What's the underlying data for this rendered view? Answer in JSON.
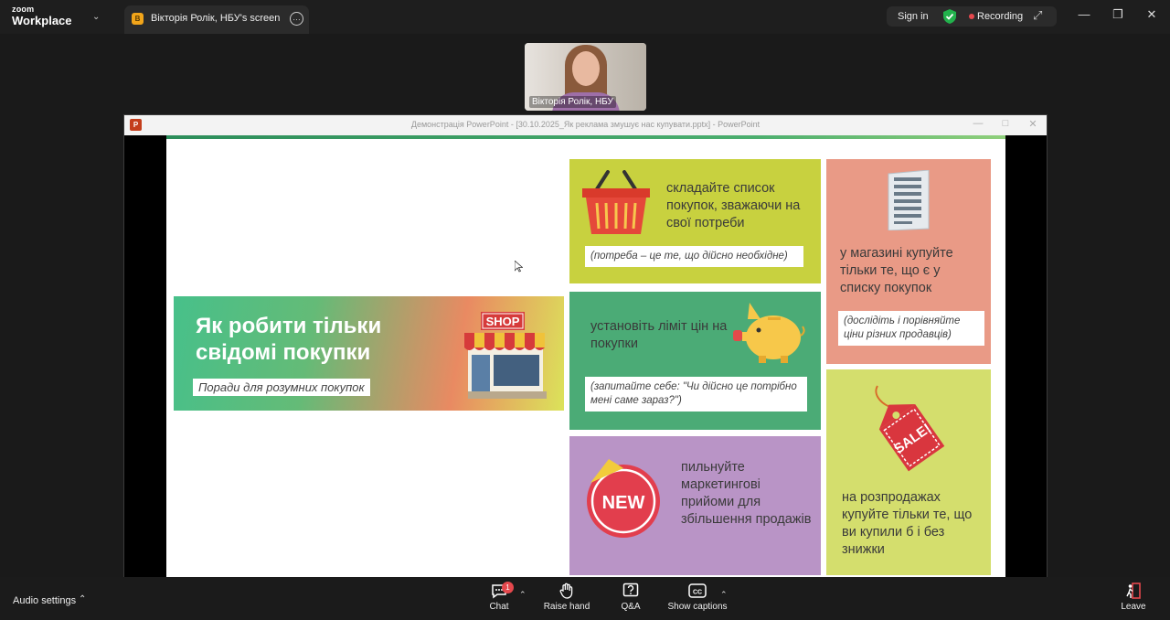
{
  "app": {
    "brand_top": "zoom",
    "brand_bottom": "Workplace"
  },
  "tab": {
    "badge_letter": "В",
    "title": "Вікторія Ролік, НБУ's screen"
  },
  "status": {
    "sign_in": "Sign in",
    "recording": "Recording"
  },
  "participant": {
    "name": "Вікторія Ролік, НБУ"
  },
  "ppt_window": {
    "caption": "Демонстрація PowerPoint - [30.10.2025_Як реклама змушує нас купувати.pptx] - PowerPoint"
  },
  "slide": {
    "hero_title": "Як робити тільки свідомі покупки",
    "hero_subtitle": "Поради для розумних покупок",
    "shop_label": "SHOP",
    "new_label": "NEW",
    "sale_label": "SALE!",
    "tip1_text": "складайте список покупок, зважаючи на свої потреби",
    "tip1_note": "(потреба – це те, що дійсно необхідне)",
    "tip2_text": "установіть ліміт цін на покупки",
    "tip2_note": "(запитайте себе: \"Чи дійсно це потрібно мені саме зараз?\")",
    "tip3_text": "пильнуйте маркетингові прийоми для збільшення продажів",
    "tip4_text": "у магазині купуйте тільки те, що є у списку покупок",
    "tip4_note": "(дослідіть і порівняйте ціни різних продавців)",
    "tip5_text": "на розпродажах купуйте тільки те, що ви купили б і без знижки"
  },
  "bottom": {
    "audio_settings": "Audio settings",
    "chat_label": "Chat",
    "chat_badge": "1",
    "raise_hand_label": "Raise hand",
    "qa_label": "Q&A",
    "captions_label": "Show captions",
    "leave_label": "Leave"
  },
  "colors": {
    "tip1_bg": "#c8d13f",
    "tip2_bg": "#4bab76",
    "tip3_bg": "#b994c6",
    "tip4_bg": "#e99a86",
    "tip5_bg": "#d4de6d",
    "recording_dot": "#e5484d",
    "shield_green": "#22b14c"
  }
}
